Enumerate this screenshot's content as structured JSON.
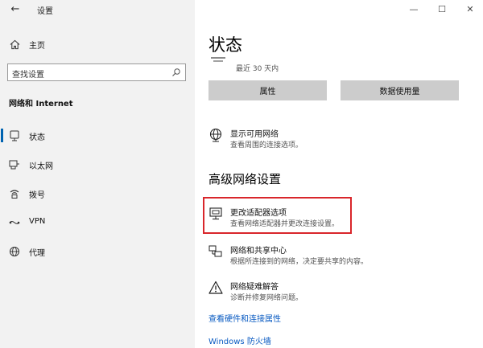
{
  "window": {
    "title": "设置",
    "back_glyph": "←",
    "controls": {
      "minimize": "—",
      "maximize": "☐",
      "close": "✕"
    }
  },
  "sidebar": {
    "home_label": "主页",
    "search_placeholder": "查找设置",
    "section_title": "网络和 Internet",
    "items": [
      {
        "label": "状态",
        "icon": "status-icon",
        "selected": true
      },
      {
        "label": "以太网",
        "icon": "ethernet-icon",
        "selected": false
      },
      {
        "label": "拨号",
        "icon": "dialup-icon",
        "selected": false
      },
      {
        "label": "VPN",
        "icon": "vpn-icon",
        "selected": false
      },
      {
        "label": "代理",
        "icon": "proxy-icon",
        "selected": false
      }
    ]
  },
  "main": {
    "title": "状态",
    "usage_text": "最近 30 天内",
    "buttons": {
      "properties": "属性",
      "data_usage": "数据使用量"
    },
    "show_networks": {
      "title": "显示可用网络",
      "desc": "查看周围的连接选项。"
    },
    "advanced_heading": "高级网络设置",
    "adapter": {
      "title": "更改适配器选项",
      "desc": "查看网络适配器并更改连接设置。"
    },
    "sharing_center": {
      "title": "网络和共享中心",
      "desc": "根据所连接到的网络，决定要共享的内容。"
    },
    "troubleshooter": {
      "title": "网络疑难解答",
      "desc": "诊断并修复网络问题。"
    },
    "links": {
      "hardware": "查看硬件和连接属性",
      "firewall": "Windows 防火墙"
    }
  },
  "colors": {
    "accent": "#0063b1",
    "link": "#0a5bc2",
    "highlight": "#d9262b",
    "sidebar_bg": "#f2f2f2",
    "button_bg": "#cccccc"
  }
}
